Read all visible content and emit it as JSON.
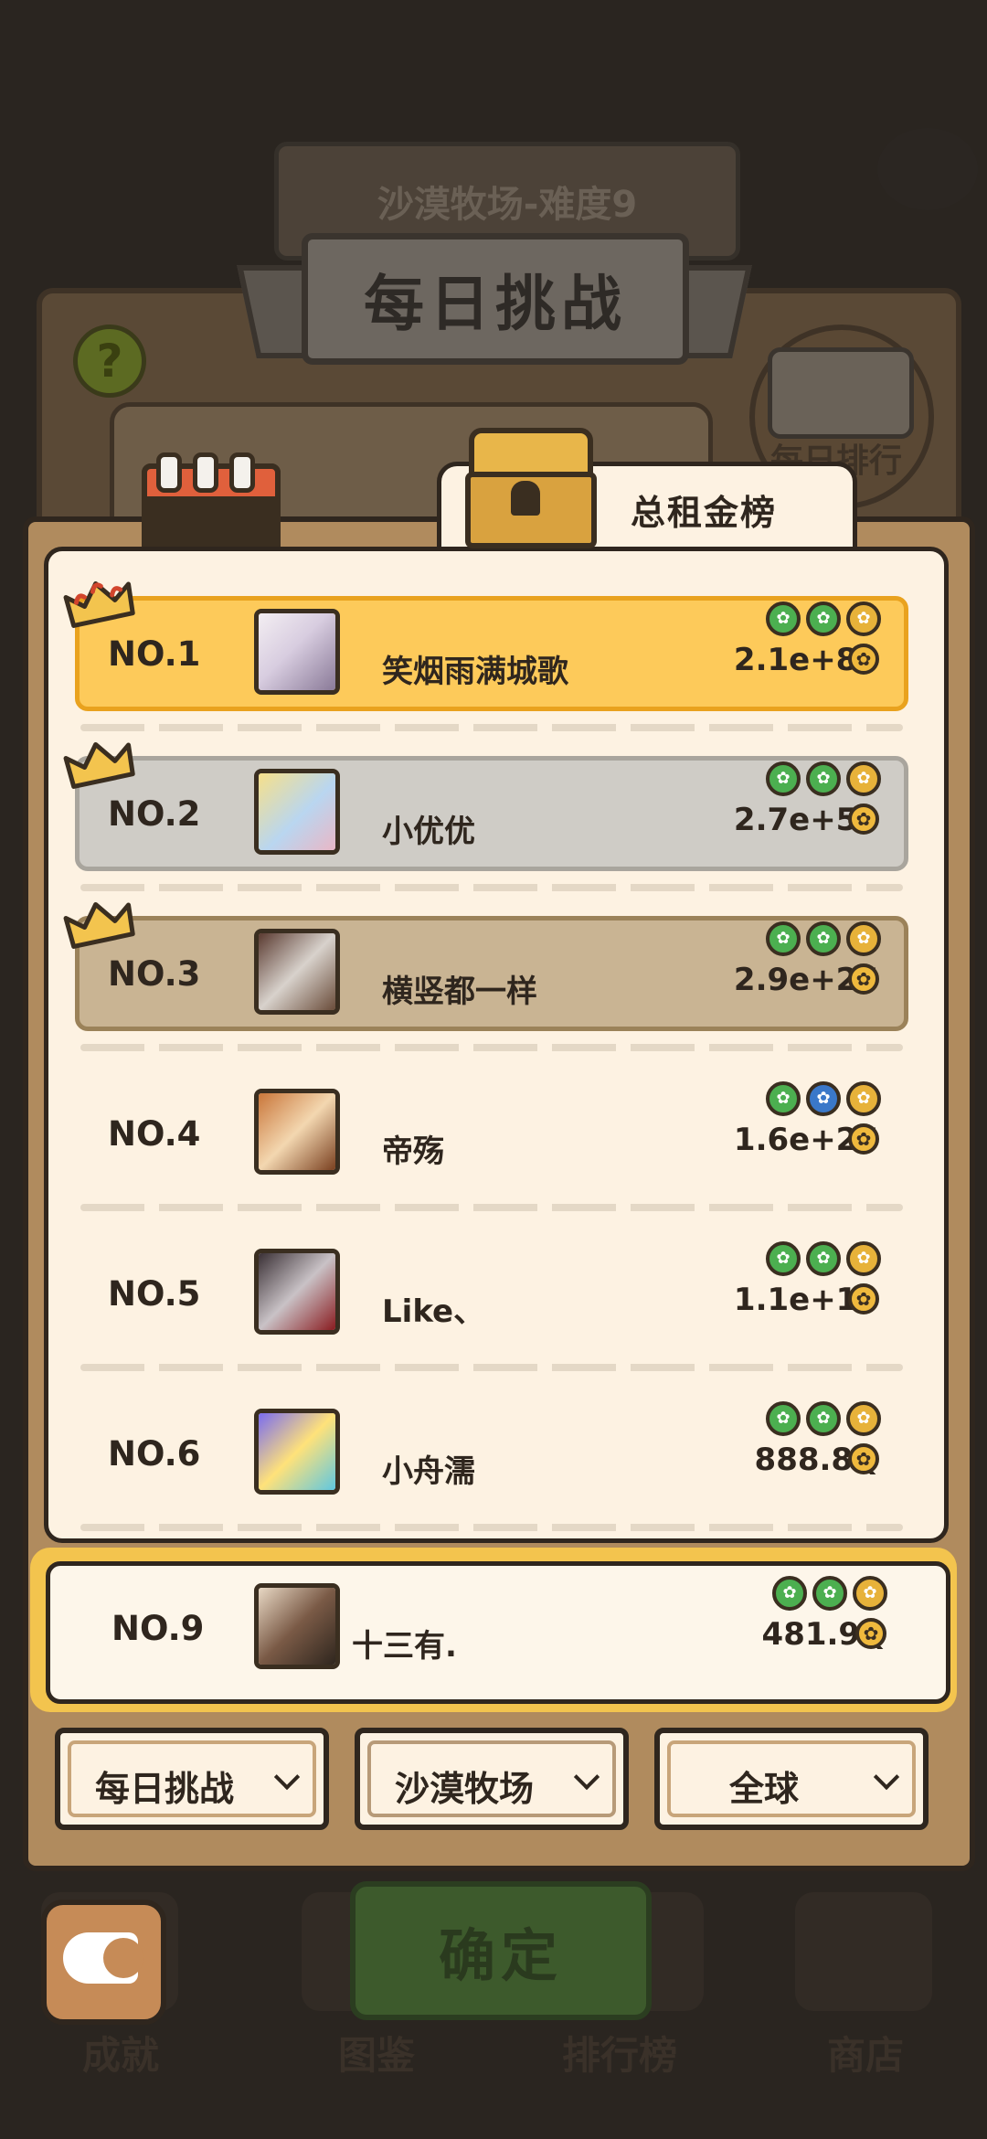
{
  "background": {
    "subtitle": "沙漠牧场-难度9",
    "title": "每日挑战",
    "help_glyph": "?",
    "daily_rank_label": "每日排行",
    "bottom_nav": [
      "成就",
      "图鉴",
      "排行榜",
      "商店"
    ]
  },
  "panel": {
    "tab_label": "总租金榜"
  },
  "rows": [
    {
      "rank": "NO.1",
      "name": "笑烟雨满城歌",
      "score": "2.1e+80",
      "tier": "gold",
      "badges": [
        "green",
        "green",
        "gold"
      ]
    },
    {
      "rank": "NO.2",
      "name": "小优优",
      "score": "2.7e+59",
      "tier": "silver",
      "badges": [
        "green",
        "green",
        "gold"
      ]
    },
    {
      "rank": "NO.3",
      "name": "横竖都一样",
      "score": "2.9e+25",
      "tier": "bronze",
      "badges": [
        "green",
        "green",
        "gold"
      ]
    },
    {
      "rank": "NO.4",
      "name": "帝殇",
      "score": "1.6e+25",
      "tier": "plain",
      "badges": [
        "green",
        "blue",
        "gold"
      ]
    },
    {
      "rank": "NO.5",
      "name": "Like、",
      "score": "1.1e+18",
      "tier": "plain",
      "badges": [
        "green",
        "green",
        "gold"
      ]
    },
    {
      "rank": "NO.6",
      "name": "小舟濡",
      "score": "888.8Q",
      "tier": "plain",
      "badges": [
        "green",
        "green",
        "gold"
      ]
    }
  ],
  "my_rank": {
    "rank": "NO.9",
    "name": "十三有.",
    "score": "481.9Q",
    "badges": [
      "green",
      "green",
      "gold"
    ]
  },
  "selectors": {
    "mode": "每日挑战",
    "map": "沙漠牧场",
    "region": "全球"
  },
  "buttons": {
    "confirm": "确定"
  },
  "colors": {
    "gold_row": "#fdca5a",
    "silver_row": "#cfccc6",
    "bronze_row": "#c9b493",
    "card_bg": "#fdf2e2",
    "badge_green": "#4caf50",
    "badge_blue": "#3a78c9",
    "badge_gold": "#e7b23a"
  },
  "icons": {
    "chest": "treasure-chest-icon",
    "calendar": "calendar-icon",
    "paw": "paw-icon",
    "crown": "crown-icon",
    "back": "back-arrow-icon"
  }
}
